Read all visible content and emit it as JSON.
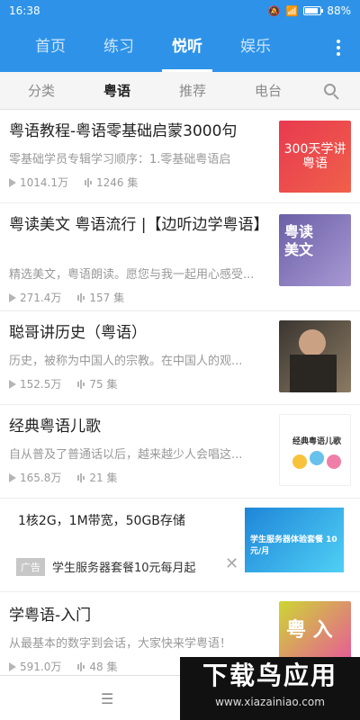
{
  "status": {
    "time": "16:38",
    "battery": "88%"
  },
  "main_tabs": [
    {
      "label": "首页",
      "active": false
    },
    {
      "label": "练习",
      "active": false
    },
    {
      "label": "悦听",
      "active": true
    },
    {
      "label": "娱乐",
      "active": false
    }
  ],
  "sub_tabs": [
    {
      "label": "分类",
      "active": false
    },
    {
      "label": "粤语",
      "active": true
    },
    {
      "label": "推荐",
      "active": false
    },
    {
      "label": "电台",
      "active": false
    }
  ],
  "items": [
    {
      "title": "粤语教程-粤语零基础启蒙3000句",
      "desc": "零基础学员专辑学习顺序：1.零基础粤语启",
      "plays": "1014.1万",
      "episodes": "1246 集",
      "thumb_text": "300天学讲粤语"
    },
    {
      "title": "粤读美文 粤语流行 |【边听边学粤语】",
      "desc": "精选美文，粤语朗读。愿您与我一起用心感受...",
      "plays": "271.4万",
      "episodes": "157 集",
      "thumb_text": "粤读美文"
    },
    {
      "title": "聪哥讲历史（粤语）",
      "desc": "历史，被称为中国人的宗教。在中国人的观...",
      "plays": "152.5万",
      "episodes": "75 集",
      "thumb_text": ""
    },
    {
      "title": "经典粤语儿歌",
      "desc": "自从普及了普通话以后，越来越少人会唱这...",
      "plays": "165.8万",
      "episodes": "21 集",
      "thumb_text": "经典粤语儿歌"
    }
  ],
  "ad": {
    "title": "1核2G，1M带宽，50GB存储",
    "badge": "广告",
    "text": "学生服务器套餐10元每月起",
    "close": "✕",
    "image_text": "学生服务器体验套餐 10元/月"
  },
  "last_item": {
    "title": "学粤语-入门",
    "desc": "从最基本的数字到会话，大家快来学粤语！",
    "plays": "591.0万",
    "episodes": "48 集",
    "thumb_text": "粤 入"
  },
  "bottom": {
    "menu": "☰"
  },
  "watermark": {
    "brand": "下载鸟应用",
    "url": "www.xiazainiao.com"
  }
}
